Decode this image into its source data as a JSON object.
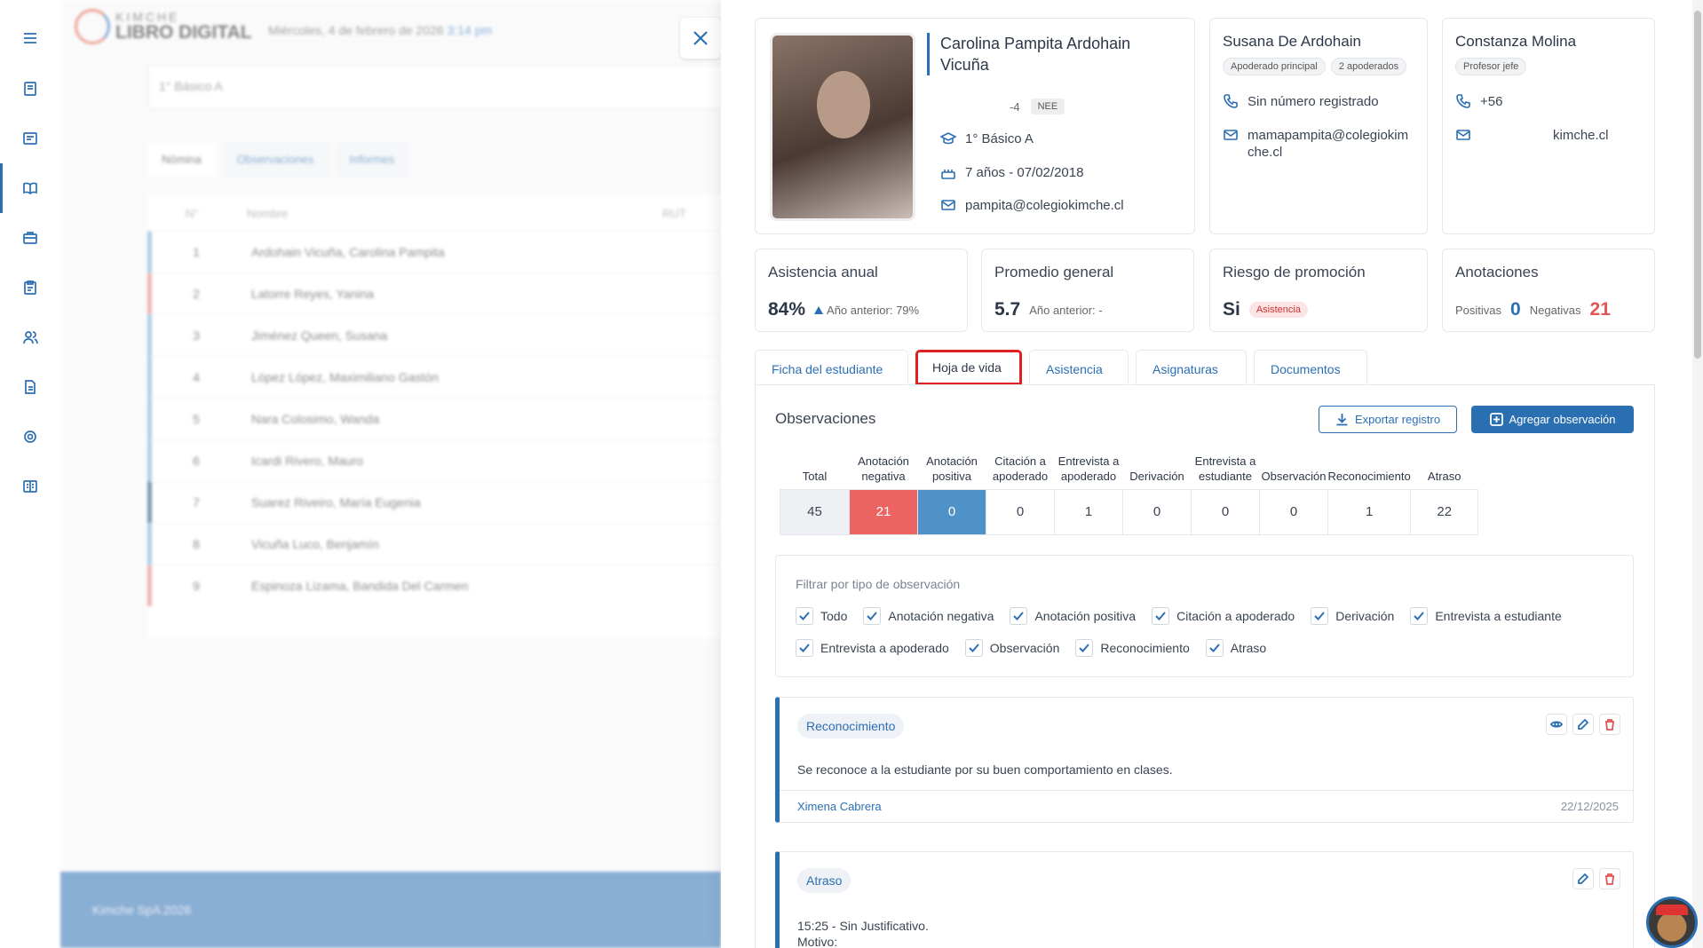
{
  "background": {
    "brand_top": "KIMCHE",
    "brand_bottom": "LIBRO DIGITAL",
    "date_text": "Miércoles, 4 de febrero de 2026",
    "time_text": "3:14 pm",
    "course_select": "1° Básico A",
    "tabs": [
      "Nómina",
      "Observaciones",
      "Informes"
    ],
    "table_headers": [
      "N°",
      "Nombre",
      "RUT"
    ],
    "rows": [
      {
        "n": "1",
        "name": "Ardohain Vicuña, Carolina Pampita"
      },
      {
        "n": "2",
        "name": "Latorre Reyes, Yanina"
      },
      {
        "n": "3",
        "name": "Jiménez Queen, Susana"
      },
      {
        "n": "4",
        "name": "López López, Maximiliano Gastón"
      },
      {
        "n": "5",
        "name": "Nara Colosimo, Wanda"
      },
      {
        "n": "6",
        "name": "Icardi Rivero, Mauro"
      },
      {
        "n": "7",
        "name": "Suarez Riveiro, María Eugenia"
      },
      {
        "n": "8",
        "name": "Vicuña Luco, Benjamín"
      },
      {
        "n": "9",
        "name": "Espinoza Lizama, Bandida Del Carmen"
      }
    ],
    "footer": "Kimche SpA 2026"
  },
  "student": {
    "name": "Carolina Pampita Ardohain Vicuña",
    "rut_suffix": "-4",
    "badge": "NEE",
    "course": "1° Básico A",
    "age": "7 años - 07/02/2018",
    "email": "pampita@colegiokimche.cl"
  },
  "guardian": {
    "name": "Susana De Ardohain",
    "chips": [
      "Apoderado principal",
      "2 apoderados"
    ],
    "phone": "Sin número registrado",
    "email": "mamapampita@colegiokimche.cl"
  },
  "teacher": {
    "name": "Constanza Molina",
    "chip": "Profesor jefe",
    "phone": "+56",
    "email": "kimche.cl"
  },
  "stats": {
    "attendance": {
      "title": "Asistencia anual",
      "value": "84%",
      "prev": "Año anterior: 79%"
    },
    "average": {
      "title": "Promedio general",
      "value": "5.7",
      "prev": "Año anterior: -"
    },
    "risk": {
      "title": "Riesgo de promoción",
      "value": "Si",
      "chip": "Asistencia"
    },
    "annotations": {
      "title": "Anotaciones",
      "pos_label": "Positivas",
      "pos": "0",
      "neg_label": "Negativas",
      "neg": "21"
    }
  },
  "tabs": [
    "Ficha del estudiante",
    "Hoja de vida",
    "Asistencia",
    "Asignaturas",
    "Documentos"
  ],
  "observations": {
    "title": "Observaciones",
    "export_label": "Exportar registro",
    "add_label": "Agregar observación",
    "summary": [
      {
        "h1": "Total",
        "h2": "",
        "v": "45",
        "cls": "tot",
        "w": 78
      },
      {
        "h1": "Anotación",
        "h2": "negativa",
        "v": "21",
        "cls": "neg",
        "w": 77
      },
      {
        "h1": "Anotación",
        "h2": "positiva",
        "v": "0",
        "cls": "pos",
        "w": 77
      },
      {
        "h1": "Citación a",
        "h2": "apoderado",
        "v": "0",
        "cls": "",
        "w": 77
      },
      {
        "h1": "Entrevista a",
        "h2": "apoderado",
        "v": "1",
        "cls": "",
        "w": 77
      },
      {
        "h1": "Derivación",
        "h2": "",
        "v": "0",
        "cls": "",
        "w": 77
      },
      {
        "h1": "Entrevista a",
        "h2": "estudiante",
        "v": "0",
        "cls": "",
        "w": 77
      },
      {
        "h1": "Observación",
        "h2": "",
        "v": "0",
        "cls": "",
        "w": 77
      },
      {
        "h1": "Reconocimiento",
        "h2": "",
        "v": "1",
        "cls": "",
        "w": 91
      },
      {
        "h1": "Atraso",
        "h2": "",
        "v": "22",
        "cls": "",
        "w": 76
      }
    ],
    "filter_title": "Filtrar por tipo de observación",
    "filters_row1": [
      "Todo",
      "Anotación negativa",
      "Anotación positiva",
      "Citación a apoderado",
      "Derivación",
      "Entrevista a estudiante"
    ],
    "filters_row2": [
      "Entrevista a apoderado",
      "Observación",
      "Reconocimiento",
      "Atraso"
    ],
    "entries": [
      {
        "tag": "Reconocimiento",
        "text": "Se reconoce a la estudiante por su buen comportamiento en clases.",
        "author": "Ximena Cabrera",
        "date": "22/12/2025"
      },
      {
        "tag": "Atraso",
        "text1": "15:25 - Sin Justificativo.",
        "text2": "Motivo:"
      }
    ]
  },
  "colors": {
    "primary": "#2b6fb3",
    "negative": "#ec6462",
    "positive": "#4f92c7",
    "highlight": "#e02020"
  }
}
